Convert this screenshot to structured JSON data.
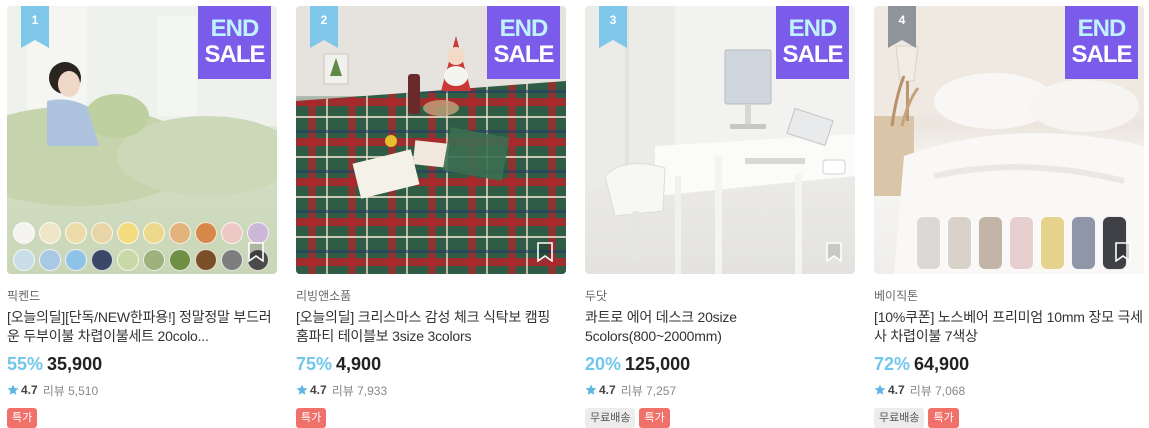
{
  "products": [
    {
      "rank": "1",
      "sale_tag": [
        "END",
        "SALE"
      ],
      "vendor": "픽켄드",
      "title": "[오늘의딜][단독/NEW한파용!] 정말정말 부드러운 두부이불 차렵이불세트 20colo...",
      "discount": "55%",
      "price": "35,900",
      "rating": "4.7",
      "reviews": "리뷰 5,510",
      "badges": [
        "특가"
      ],
      "swatches": [
        "#f5f4f0",
        "#efe6c8",
        "#eddcaa",
        "#e8d6a8",
        "#f2dc7f",
        "#ecd98b",
        "#e2b37c",
        "#d6884b",
        "#ecc9c4",
        "#cdb7d8",
        "#c9dde6",
        "#a9c8e4",
        "#8ec2e6",
        "#3b4766",
        "#c6d9a7",
        "#9db27d",
        "#6f8f45",
        "#7a4f27",
        "#7d7d7d",
        "#4a4a4a"
      ]
    },
    {
      "rank": "2",
      "sale_tag": [
        "END",
        "SALE"
      ],
      "vendor": "리빙앤소품",
      "title": "[오늘의딜] 크리스마스 감성 체크 식탁보 캠핑 홈파티 테이블보 3size 3colors",
      "discount": "75%",
      "price": "4,900",
      "rating": "4.7",
      "reviews": "리뷰 7,933",
      "badges": [
        "특가"
      ]
    },
    {
      "rank": "3",
      "sale_tag": [
        "END",
        "SALE"
      ],
      "vendor": "두닷",
      "title": "콰트로 에어 데스크 20size 5colors(800~2000mm)",
      "discount": "20%",
      "price": "125,000",
      "rating": "4.7",
      "reviews": "리뷰 7,257",
      "badges": [
        "무료배송",
        "특가"
      ]
    },
    {
      "rank": "4",
      "sale_tag": [
        "END",
        "SALE"
      ],
      "vendor": "베이직톤",
      "title": "[10%쿠폰] 노스베어 프리미엄 10mm 장모 극세사 차렵이불 7색상",
      "discount": "72%",
      "price": "64,900",
      "rating": "4.7",
      "reviews": "리뷰 7,068",
      "badges": [
        "무료배송",
        "특가"
      ],
      "swatches": [
        "#dcd8d4",
        "#d8d2cb",
        "#c2b4a6",
        "#e8cfcf",
        "#e5d28c",
        "#8e96a8",
        "#3f4146"
      ]
    }
  ]
}
